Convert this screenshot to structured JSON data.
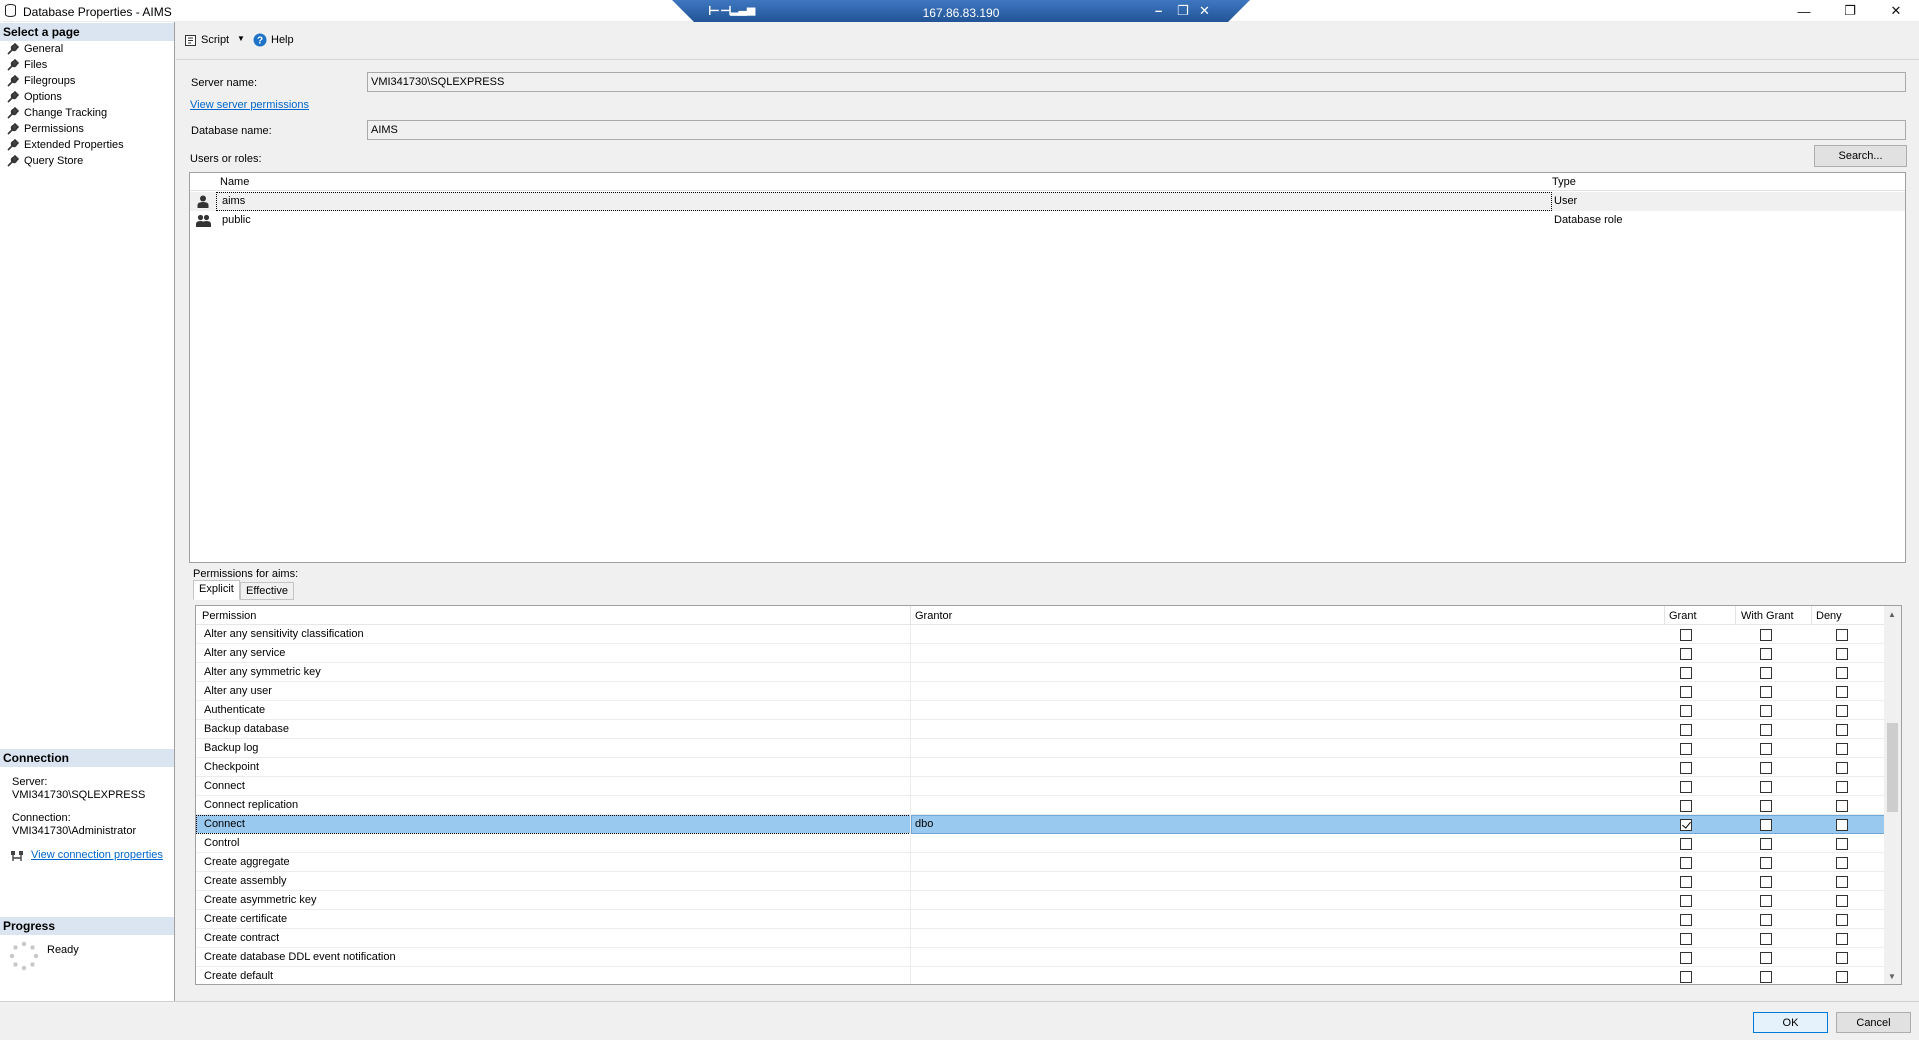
{
  "window": {
    "title": "Database Properties - AIMS",
    "remote_host": "167.86.83.190"
  },
  "left_panel": {
    "select_page_header": "Select a page",
    "pages": [
      "General",
      "Files",
      "Filegroups",
      "Options",
      "Change Tracking",
      "Permissions",
      "Extended Properties",
      "Query Store"
    ],
    "connection_header": "Connection",
    "server_label": "Server:",
    "server_value": "VMI341730\\SQLEXPRESS",
    "connection_label": "Connection:",
    "connection_value": "VMI341730\\Administrator",
    "view_connection_properties": "View connection properties",
    "progress_header": "Progress",
    "progress_status": "Ready"
  },
  "toolbar": {
    "script_label": "Script",
    "help_label": "Help"
  },
  "form": {
    "server_name_label": "Server name:",
    "server_name_value": "VMI341730\\SQLEXPRESS",
    "view_server_permissions": "View server permissions",
    "database_name_label": "Database name:",
    "database_name_value": "AIMS",
    "users_or_roles_label": "Users or roles:",
    "search_button": "Search..."
  },
  "users_grid": {
    "columns": [
      "Name",
      "Type"
    ],
    "rows": [
      {
        "name": "aims",
        "type": "User",
        "icon": "user-icon"
      },
      {
        "name": "public",
        "type": "Database role",
        "icon": "role-icon"
      }
    ]
  },
  "permissions": {
    "label": "Permissions for aims:",
    "tabs": [
      "Explicit",
      "Effective"
    ],
    "columns": [
      "Permission",
      "Grantor",
      "Grant",
      "With Grant",
      "Deny"
    ],
    "rows": [
      {
        "permission": "Alter any sensitivity classification",
        "grantor": "",
        "grant": false,
        "with_grant": false,
        "deny": false
      },
      {
        "permission": "Alter any service",
        "grantor": "",
        "grant": false,
        "with_grant": false,
        "deny": false
      },
      {
        "permission": "Alter any symmetric key",
        "grantor": "",
        "grant": false,
        "with_grant": false,
        "deny": false
      },
      {
        "permission": "Alter any user",
        "grantor": "",
        "grant": false,
        "with_grant": false,
        "deny": false
      },
      {
        "permission": "Authenticate",
        "grantor": "",
        "grant": false,
        "with_grant": false,
        "deny": false
      },
      {
        "permission": "Backup database",
        "grantor": "",
        "grant": false,
        "with_grant": false,
        "deny": false
      },
      {
        "permission": "Backup log",
        "grantor": "",
        "grant": false,
        "with_grant": false,
        "deny": false
      },
      {
        "permission": "Checkpoint",
        "grantor": "",
        "grant": false,
        "with_grant": false,
        "deny": false
      },
      {
        "permission": "Connect",
        "grantor": "",
        "grant": false,
        "with_grant": false,
        "deny": false
      },
      {
        "permission": "Connect replication",
        "grantor": "",
        "grant": false,
        "with_grant": false,
        "deny": false
      },
      {
        "permission": "Connect",
        "grantor": "dbo",
        "grant": true,
        "with_grant": false,
        "deny": false,
        "selected": true
      },
      {
        "permission": "Control",
        "grantor": "",
        "grant": false,
        "with_grant": false,
        "deny": false
      },
      {
        "permission": "Create aggregate",
        "grantor": "",
        "grant": false,
        "with_grant": false,
        "deny": false
      },
      {
        "permission": "Create assembly",
        "grantor": "",
        "grant": false,
        "with_grant": false,
        "deny": false
      },
      {
        "permission": "Create asymmetric key",
        "grantor": "",
        "grant": false,
        "with_grant": false,
        "deny": false
      },
      {
        "permission": "Create certificate",
        "grantor": "",
        "grant": false,
        "with_grant": false,
        "deny": false
      },
      {
        "permission": "Create contract",
        "grantor": "",
        "grant": false,
        "with_grant": false,
        "deny": false
      },
      {
        "permission": "Create database DDL event notification",
        "grantor": "",
        "grant": false,
        "with_grant": false,
        "deny": false
      },
      {
        "permission": "Create default",
        "grantor": "",
        "grant": false,
        "with_grant": false,
        "deny": false
      }
    ]
  },
  "buttons": {
    "ok": "OK",
    "cancel": "Cancel"
  },
  "colors": {
    "section_header_bg": "#dbe5f1",
    "selection_bg": "#99c9ef",
    "link": "#0066cc",
    "rdp_bar": "#2a5fa4"
  }
}
